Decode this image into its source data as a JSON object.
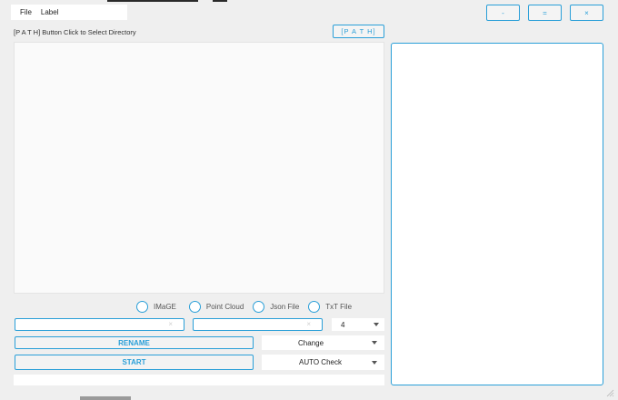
{
  "menu": {
    "items": [
      "File",
      "Label"
    ]
  },
  "window_controls": {
    "minimize": "-",
    "maximize": "=",
    "close": "×"
  },
  "path": {
    "hint": "[P A T H] Button Click to Select Directory",
    "button_label": "[P A T H]"
  },
  "file_types": {
    "options": [
      "IMaGE",
      "Point Cloud",
      "Json File",
      "TxT File"
    ],
    "accent": "#2a9fd8"
  },
  "inputs": {
    "first_value": "",
    "second_value": "",
    "clear_glyph": "×"
  },
  "digit_select": {
    "value": "4"
  },
  "rename": {
    "button_label": "RENAME",
    "mode_select": "Change"
  },
  "start": {
    "button_label": "START",
    "check_select": "AUTO Check"
  },
  "status": {
    "text": ""
  },
  "icons": {
    "select_arrow": "chevron-down-icon",
    "resize": "resize-grip-icon",
    "clear": "clear-icon"
  }
}
